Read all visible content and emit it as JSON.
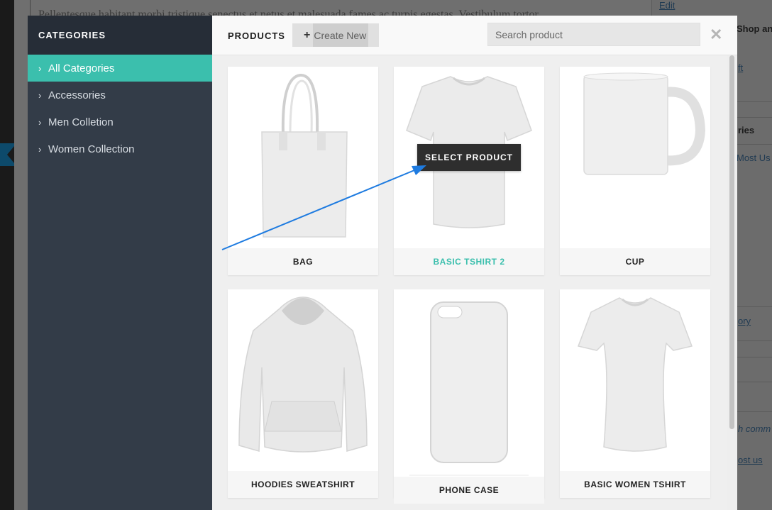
{
  "background": {
    "editor_text": "Pellentesque habitant morbi tristique senectus et netus et malesuada fames ac turpis egestas. Vestibulum tortor",
    "right_edit": "Edit",
    "right_shop": "Shop an",
    "right_ft": "ft",
    "right_ries": "ries",
    "right_most_used": "Most Us",
    "right_ory": "ory",
    "right_h_comm": "h comm",
    "right_most_used_2": "ost us"
  },
  "sidebar": {
    "title": "CATEGORIES",
    "items": [
      {
        "label": "All Categories",
        "active": true
      },
      {
        "label": "Accessories",
        "active": false
      },
      {
        "label": "Men Colletion",
        "active": false
      },
      {
        "label": "Women Collection",
        "active": false
      }
    ]
  },
  "header": {
    "title": "PRODUCTS",
    "create_label": "Create New",
    "search_placeholder": "Search product"
  },
  "products": [
    {
      "name": "BAG",
      "highlighted": false
    },
    {
      "name": "BASIC TSHIRT 2",
      "highlighted": true,
      "hover_action": "SELECT PRODUCT"
    },
    {
      "name": "CUP",
      "highlighted": false
    },
    {
      "name": "HOODIES SWEATSHIRT",
      "highlighted": false
    },
    {
      "name": "PHONE CASE",
      "highlighted": false
    },
    {
      "name": "BASIC WOMEN TSHIRT",
      "highlighted": false
    }
  ],
  "colors": {
    "accent": "#3bbfad",
    "sidebar_bg": "#333c48",
    "annotation_arrow": "#1e7be0"
  }
}
